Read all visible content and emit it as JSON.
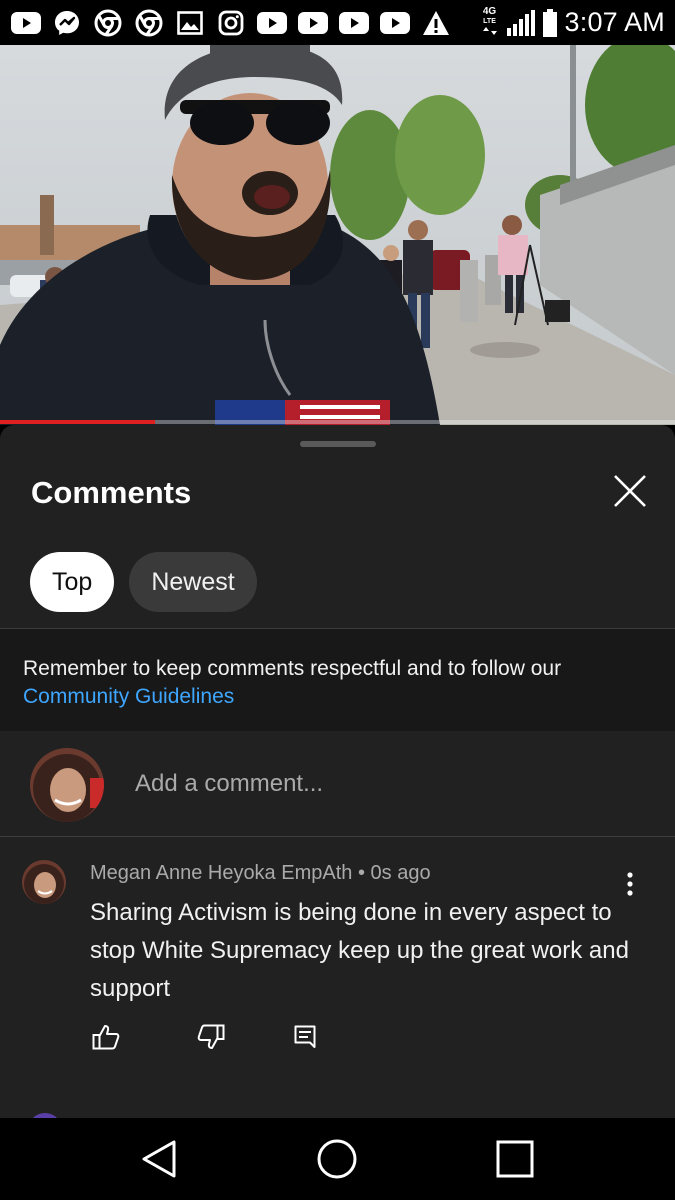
{
  "status_bar": {
    "time": "3:07 AM",
    "network": "4G",
    "network_sub": "LTE",
    "notification_icons": [
      "youtube-icon",
      "messenger-icon",
      "chrome-icon",
      "chrome-icon",
      "gallery-icon",
      "instagram-icon",
      "youtube-icon",
      "youtube-icon",
      "youtube-icon",
      "youtube-icon",
      "warning-icon"
    ]
  },
  "video": {
    "progress": 0.23,
    "progress_color": "#e02020"
  },
  "comments_panel": {
    "title": "Comments",
    "filters": [
      {
        "label": "Top",
        "active": true
      },
      {
        "label": "Newest",
        "active": false
      }
    ],
    "guidelines_text": "Remember to keep comments respectful and to follow our",
    "guidelines_link": "Community Guidelines",
    "add_comment_placeholder": "Add a comment...",
    "comments": [
      {
        "author": "Megan Anne Heyoka EmpAth",
        "time": "0s ago",
        "separator": "•",
        "text": "Sharing Activism is being done in every aspect to stop White Supremacy keep up the great work and support"
      }
    ]
  },
  "colors": {
    "sheet_bg": "#212121",
    "guidelines_bg": "#181818",
    "link": "#3ea6ff",
    "secondary_text": "#aaaaaa"
  }
}
